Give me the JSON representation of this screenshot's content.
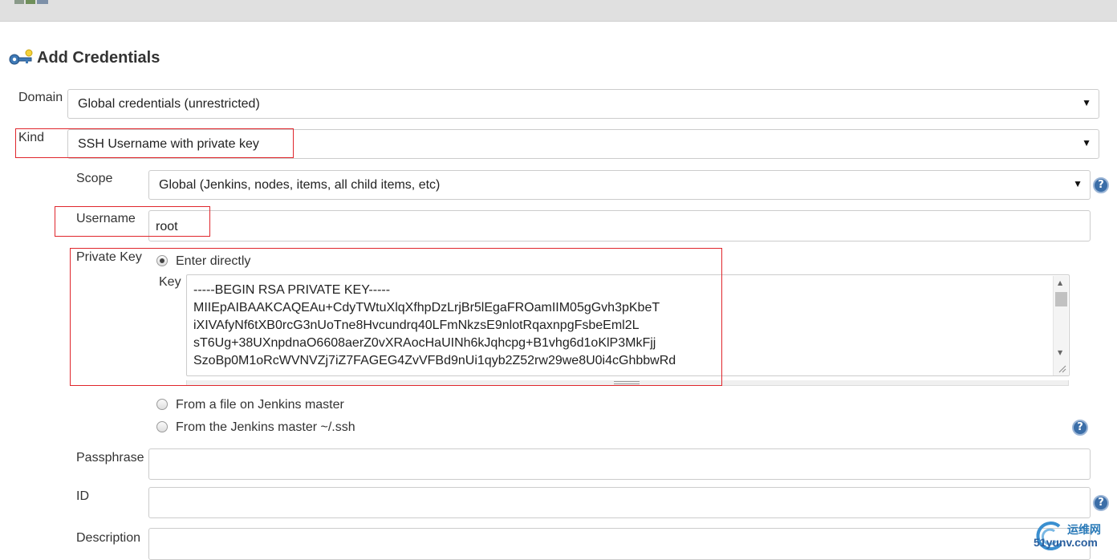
{
  "header": {
    "title": "Add Credentials"
  },
  "domain": {
    "label": "Domain",
    "value": "Global credentials (unrestricted)"
  },
  "kind": {
    "label": "Kind",
    "value": "SSH Username with private key"
  },
  "scope": {
    "label": "Scope",
    "value": "Global (Jenkins, nodes, items, all child items, etc)"
  },
  "username": {
    "label": "Username",
    "value": "root"
  },
  "private_key": {
    "label": "Private Key",
    "options": [
      {
        "label": "Enter directly",
        "selected": true
      },
      {
        "label": "From a file on Jenkins master",
        "selected": false
      },
      {
        "label": "From the Jenkins master ~/.ssh",
        "selected": false
      }
    ],
    "key_label": "Key",
    "key_lines": [
      "-----BEGIN RSA PRIVATE KEY-----",
      "MIIEpAIBAAKCAQEAu+CdyTWtuXlqXfhpDzLrjBr5lEgaFROamIIM05gGvh3pKbeT",
      "iXIVAfyNf6tXB0rcG3nUoTne8Hvcundrq40LFmNkzsE9nlotRqaxnpgFsbeEml2L",
      "sT6Ug+38UXnpdnaO6608aerZ0vXRAocHaUINh6kJqhcpg+B1vhg6d1oKlP3MkFjj",
      "SzoBp0M1oRcWVNVZj7iZ7FAGEG4ZvVFBd9nUi1qyb2Z52rw29we8U0i4cGhbbwRd"
    ]
  },
  "passphrase": {
    "label": "Passphrase",
    "value": ""
  },
  "id_field": {
    "label": "ID",
    "value": ""
  },
  "description": {
    "label": "Description",
    "value": ""
  },
  "help_icon_text": "?",
  "watermark": {
    "cn": "运维网",
    "en": "51yunv.com"
  },
  "colors": {
    "highlight": "#e0262c",
    "help": "#3b6ea8"
  }
}
